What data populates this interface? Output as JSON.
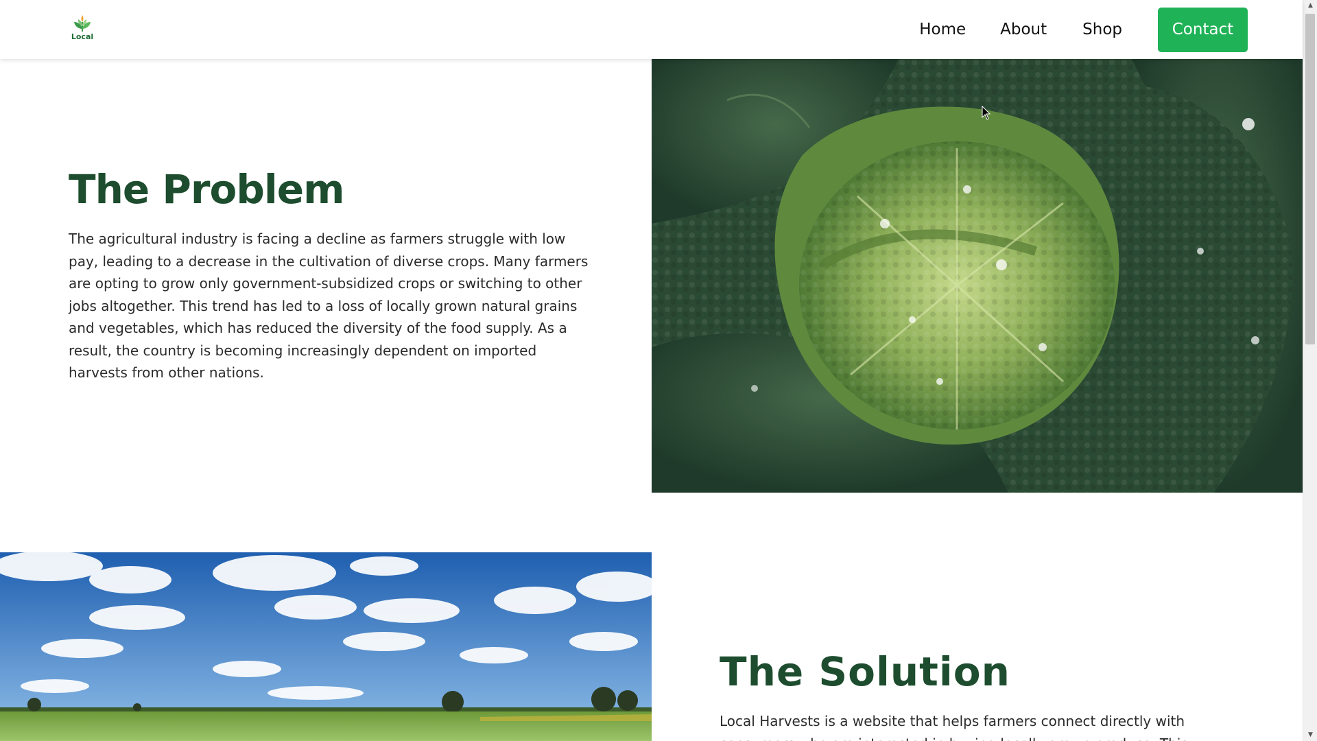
{
  "header": {
    "logo_text": "Local",
    "nav": {
      "home": "Home",
      "about": "About",
      "shop": "Shop",
      "contact": "Contact"
    }
  },
  "problem": {
    "title": "The Problem",
    "body": "The agricultural industry is facing a decline as farmers struggle with low pay, leading to a decrease in the cultivation of diverse crops. Many farmers are opting to grow only government-subsidized crops or switching to other jobs altogether. This trend has led to a loss of locally grown natural grains and vegetables, which has reduced the diversity of the food supply. As a result, the country is becoming increasingly dependent on imported harvests from other nations."
  },
  "solution": {
    "title": "The Solution",
    "body": "Local Harvests is a website that helps farmers connect directly with consumers who are interested in buying locally grown produce. This"
  },
  "icons": {
    "logo": "leaf-sprout-logo-icon",
    "cursor": "mouse-pointer-icon",
    "scroll_up": "arrow-up-icon",
    "scroll_down": "arrow-down-icon"
  },
  "colors": {
    "accent": "#1fb257",
    "heading": "#1d4d2e",
    "logo_green": "#1e6b34",
    "logo_orange": "#f0a030"
  }
}
